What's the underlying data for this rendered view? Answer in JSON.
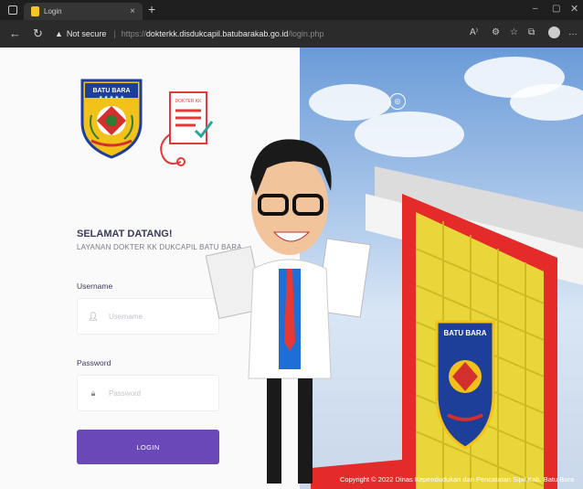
{
  "browser": {
    "tab_title": "Login",
    "new_tab_symbol": "+",
    "close_symbol": "×",
    "security_label": "Not secure",
    "url_protocol": "https://",
    "url_host": "dokterkk.disdukcapil.batubarakab.go.id",
    "url_path": "/login.php"
  },
  "logo": {
    "text_top": "BATU BARA",
    "doc_label": "DOKTER KK"
  },
  "login": {
    "welcome": "SELAMAT DATANG!",
    "subtitle": "LAYANAN DOKTER KK DUKCAPIL BATU BARA",
    "username_label": "Username",
    "username_placeholder": "Username",
    "password_label": "Password",
    "password_placeholder": "Password",
    "login_button": "LOGIN"
  },
  "building": {
    "emblem_text": "BATU BARA"
  },
  "footer": {
    "copyright": "Copyright © 2022 Dinas Kependudukan dan Pencatatan Sipil Kab. Batu Bara"
  },
  "icons": {
    "back": "back-arrow-icon",
    "refresh": "refresh-icon",
    "lock": "warning-icon",
    "user": "user-icon",
    "password": "lock-icon"
  },
  "colors": {
    "login_button": "#6a48b8",
    "frame_red": "#e52a2a",
    "lattice_yellow": "#e9d63a",
    "shield_blue": "#1d3f9a",
    "shield_yellow": "#f2c21b"
  }
}
